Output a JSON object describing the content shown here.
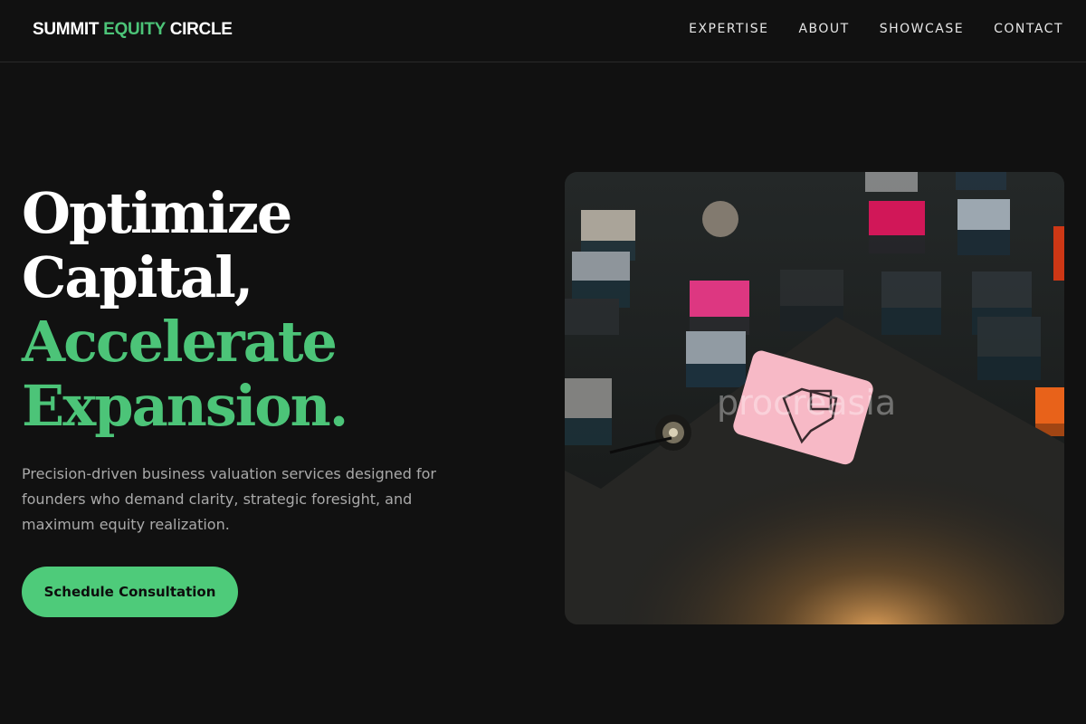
{
  "header": {
    "logo_part1": "SUMMIT ",
    "logo_part2": "EQUITY",
    "logo_part3": " CIRCLE",
    "nav": [
      "EXPERTISE",
      "ABOUT",
      "SHOWCASE",
      "CONTACT"
    ]
  },
  "hero": {
    "headline_line1": "Optimize",
    "headline_line2": "Capital,",
    "headline_line3": "Accelerate",
    "headline_line4": "Expansion.",
    "description": "Precision-driven business valuation services designed for founders who demand clarity, strategic foresight, and maximum equity realization.",
    "cta_label": "Schedule Consultation",
    "image_watermark": "procreasia"
  },
  "colors": {
    "accent": "#4cc478",
    "background": "#111111",
    "button": "#4ecb7a"
  }
}
